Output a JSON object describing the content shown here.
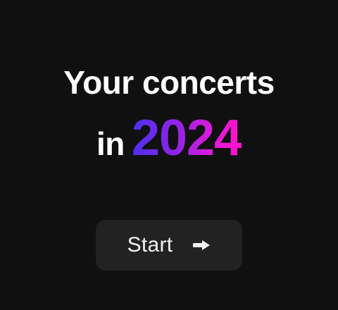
{
  "hero": {
    "title_line1": "Your concerts",
    "title_line2_prefix": "in",
    "title_year": "2024"
  },
  "start_button": {
    "label": "Start",
    "icon": "arrow-right-icon"
  },
  "colors": {
    "background": "#101010",
    "button_background": "#222222",
    "text": "#ffffff",
    "gradient_start": "#4a2ff0",
    "gradient_end": "#ff12c8"
  }
}
